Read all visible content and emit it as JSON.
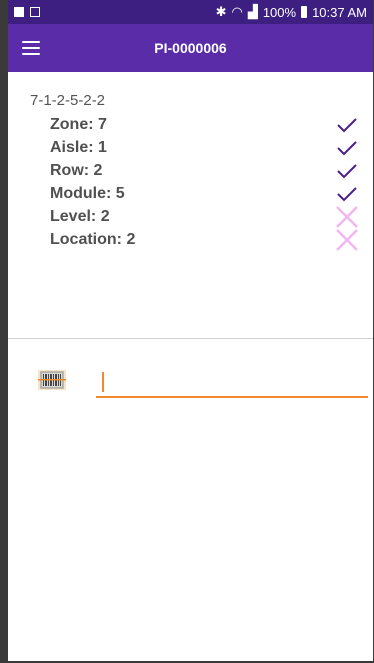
{
  "status_bar": {
    "time": "10:37 AM",
    "battery": "100%",
    "icons": [
      "image-icon",
      "notification-icon",
      "bluetooth-icon",
      "wifi-icon",
      "signal-icon",
      "battery-icon"
    ]
  },
  "app_bar": {
    "title": "PI-0000006",
    "menu_icon": "hamburger-menu-icon"
  },
  "location": {
    "code": "7-1-2-5-2-2",
    "fields": [
      {
        "label": "Zone: 7",
        "status": "check"
      },
      {
        "label": "Aisle: 1",
        "status": "check"
      },
      {
        "label": "Row: 2",
        "status": "check"
      },
      {
        "label": "Module: 5",
        "status": "check"
      },
      {
        "label": "Level: 2",
        "status": "cross"
      },
      {
        "label": "Location: 2",
        "status": "cross"
      }
    ]
  },
  "scan": {
    "value": "",
    "placeholder": ""
  },
  "colors": {
    "status_bar": "#3c1f80",
    "app_bar": "#5a2ca8",
    "check": "#4b1f8a",
    "cross": "#f2b6ef",
    "accent": "#f08a2c"
  }
}
